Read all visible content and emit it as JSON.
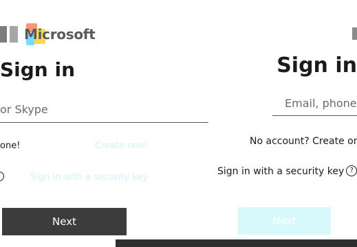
{
  "logo": {
    "brand": "Microsoft"
  },
  "left_panel": {
    "title": "Sign in",
    "email_placeholder": "or Skype",
    "no_account_text": "one!",
    "create_link": "Create one!",
    "security_key_link": "Sign in with a security key",
    "next_button": "Next"
  },
  "right_panel": {
    "title": "Sign in",
    "email_placeholder": "Email, phone",
    "no_account_text": "No account? ",
    "create_link": "Create one!",
    "security_key_link": "Sign in with a security key",
    "help_icon_glyph": "?",
    "next_button": "Next"
  },
  "colors": {
    "primary_button": "#3c3c3c",
    "faded_button": "#d7f9fc",
    "faded_link": "#d0f4fb",
    "text": "#1b1b1b"
  }
}
